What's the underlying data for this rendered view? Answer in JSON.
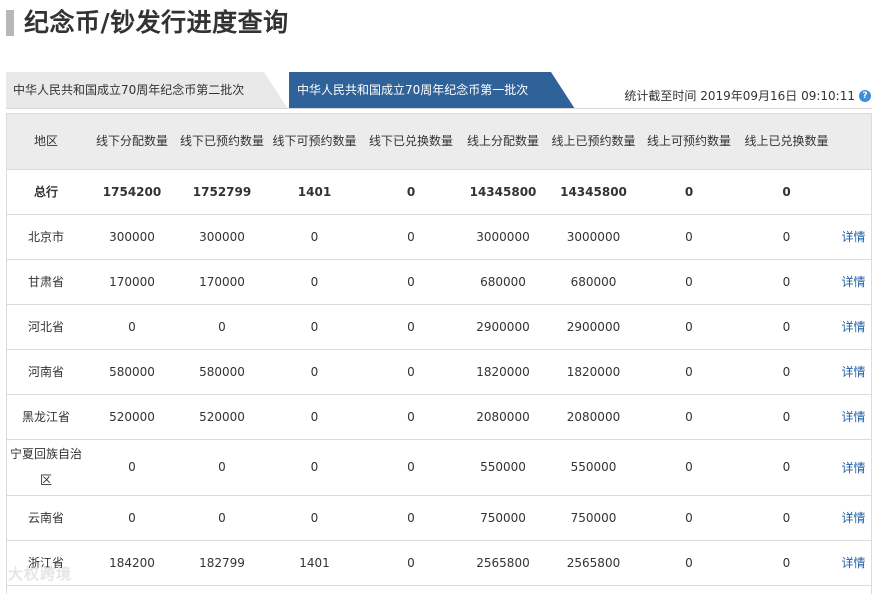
{
  "page": {
    "title": "纪念币/钞发行进度查询"
  },
  "tabs": [
    {
      "label": "中华人民共和国成立70周年纪念币第二批次",
      "active": false
    },
    {
      "label": "中华人民共和国成立70周年纪念币第一批次",
      "active": true
    }
  ],
  "stat": {
    "text": "统计截至时间 2019年09月16日 09:10:11"
  },
  "table": {
    "headers": [
      "地区",
      "线下分配数量",
      "线下已预约数量",
      "线下可预约数量",
      "线下已兑换数量",
      "线上分配数量",
      "线上已预约数量",
      "线上可预约数量",
      "线上已兑换数量",
      ""
    ],
    "total": [
      "总行",
      "1754200",
      "1752799",
      "1401",
      "0",
      "14345800",
      "14345800",
      "0",
      "0"
    ],
    "detail_label": "详情",
    "rows": [
      [
        "北京市",
        "300000",
        "300000",
        "0",
        "0",
        "3000000",
        "3000000",
        "0",
        "0"
      ],
      [
        "甘肃省",
        "170000",
        "170000",
        "0",
        "0",
        "680000",
        "680000",
        "0",
        "0"
      ],
      [
        "河北省",
        "0",
        "0",
        "0",
        "0",
        "2900000",
        "2900000",
        "0",
        "0"
      ],
      [
        "河南省",
        "580000",
        "580000",
        "0",
        "0",
        "1820000",
        "1820000",
        "0",
        "0"
      ],
      [
        "黑龙江省",
        "520000",
        "520000",
        "0",
        "0",
        "2080000",
        "2080000",
        "0",
        "0"
      ],
      [
        "宁夏回族自治区",
        "0",
        "0",
        "0",
        "0",
        "550000",
        "550000",
        "0",
        "0"
      ],
      [
        "云南省",
        "0",
        "0",
        "0",
        "0",
        "750000",
        "750000",
        "0",
        "0"
      ],
      [
        "浙江省",
        "184200",
        "182799",
        "1401",
        "0",
        "2565800",
        "2565800",
        "0",
        "0"
      ]
    ]
  },
  "watermark": {
    "text": "大权跨境"
  },
  "colors": {
    "active_tab": "#2e6299",
    "inactive_tab": "#e9e9e9",
    "link": "#1f5fa8",
    "header_bg": "#ececec"
  }
}
